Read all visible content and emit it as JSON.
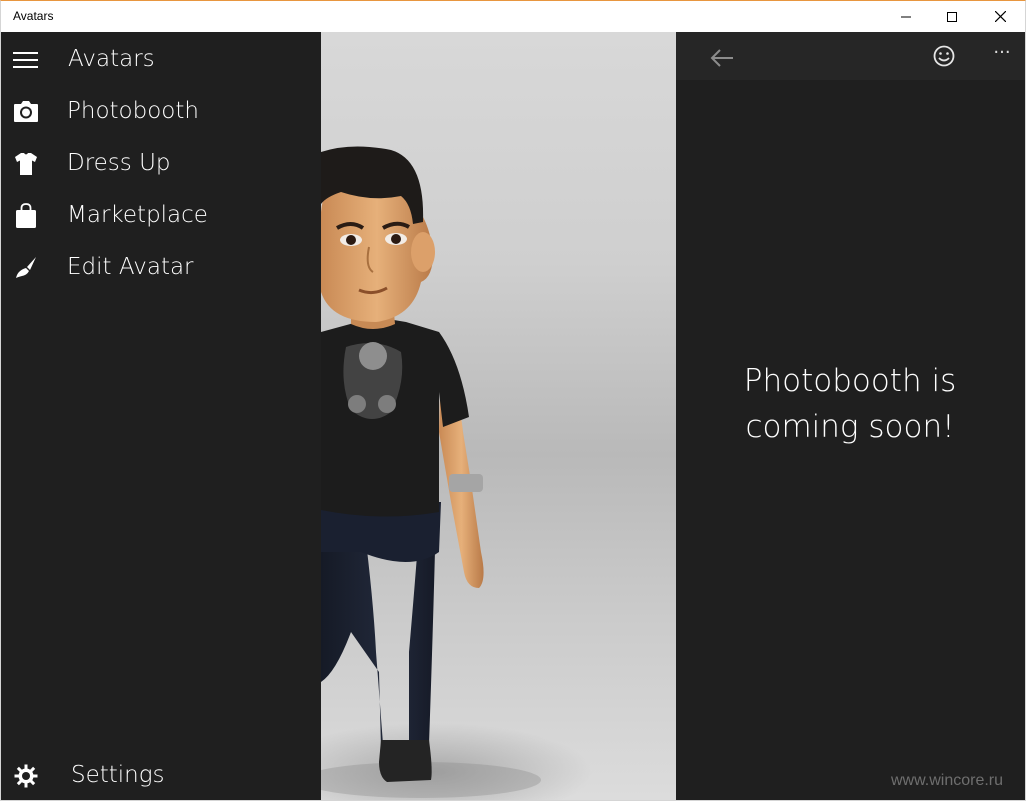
{
  "window": {
    "title": "Avatars",
    "accent_color": "#e8963f"
  },
  "nav": {
    "header": {
      "icon": "hamburger-icon",
      "label": "Avatars"
    },
    "items": [
      {
        "icon": "camera-icon",
        "label": "Photobooth"
      },
      {
        "icon": "shirt-icon",
        "label": "Dress Up"
      },
      {
        "icon": "shopping-bag-icon",
        "label": "Marketplace"
      },
      {
        "icon": "brush-icon",
        "label": "Edit Avatar"
      }
    ],
    "settings": {
      "icon": "gear-icon",
      "label": "Settings"
    }
  },
  "right_pane": {
    "back_icon": "back-arrow-icon",
    "emoji_icon": "smiley-icon",
    "more_label": "···",
    "message_line1": "Photobooth is",
    "message_line2": "coming soon!"
  },
  "watermark": "www.wincore.ru",
  "colors": {
    "nav_background": "#1f1f1f",
    "header_background": "#262626",
    "text": "#ffffff"
  }
}
